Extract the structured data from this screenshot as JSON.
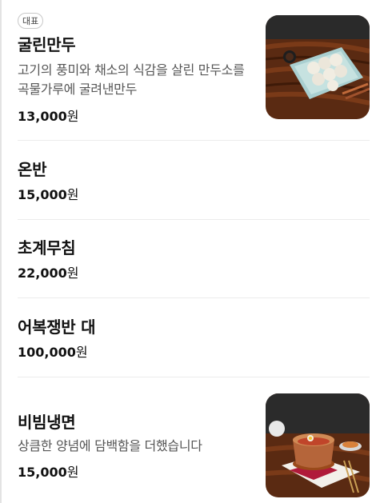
{
  "menu": {
    "items": [
      {
        "badge": "대표",
        "name": "굴린만두",
        "description": "고기의 풍미와 채소의 식감을 살린 만두소를 곡물가루에 굴려낸만두",
        "price": "13,000",
        "currency": "원",
        "image": "dumplings-photo"
      },
      {
        "name": "온반",
        "price": "15,000",
        "currency": "원"
      },
      {
        "name": "초계무침",
        "price": "22,000",
        "currency": "원"
      },
      {
        "name": "어복쟁반 대",
        "price": "100,000",
        "currency": "원"
      },
      {
        "name": "비빔냉면",
        "description": "상큼한 양념에 담백함을 더했습니다",
        "price": "15,000",
        "currency": "원",
        "image": "bibim-naengmyeon-photo"
      }
    ]
  }
}
